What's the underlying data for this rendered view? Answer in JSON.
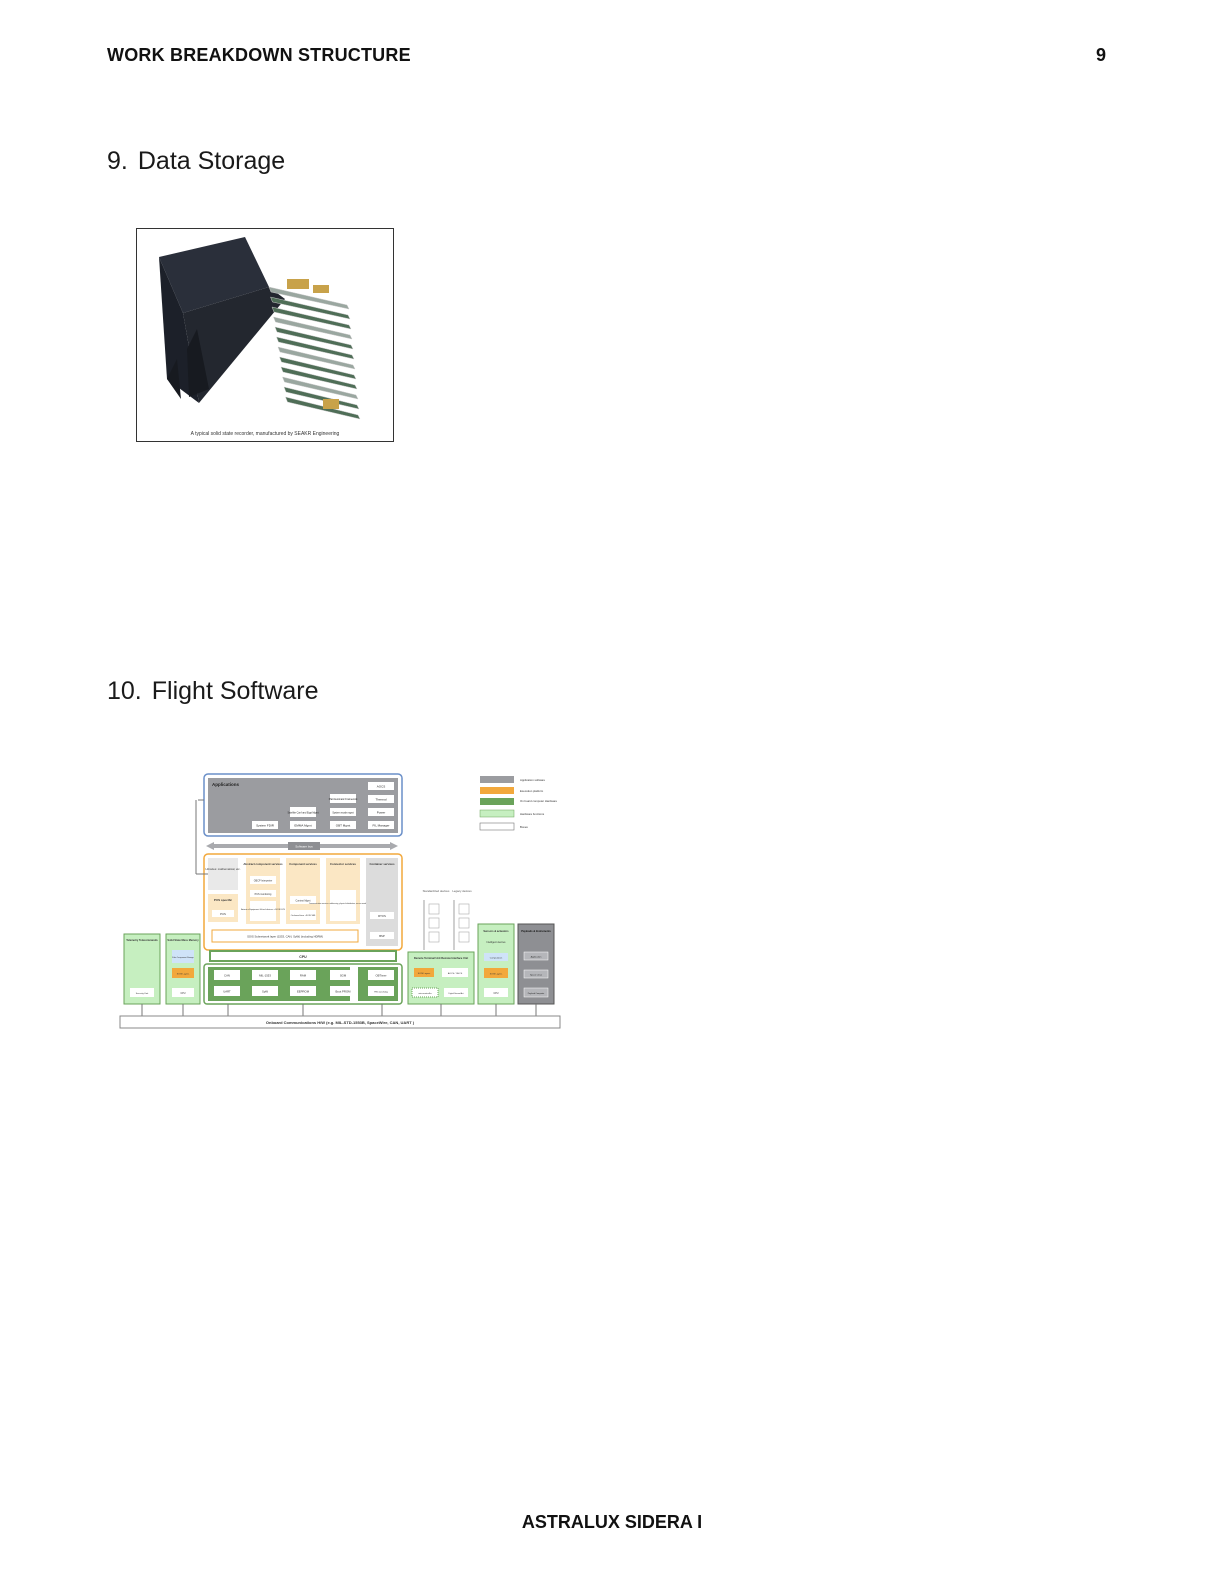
{
  "header": {
    "title": "WORK BREAKDOWN STRUCTURE",
    "page_number": "9"
  },
  "sections": [
    {
      "number": "9.",
      "title": "Data Storage"
    },
    {
      "number": "10.",
      "title": "Flight Software"
    }
  ],
  "figure_photo": {
    "caption": "A typical solid state recorder, manufactured by SEAKR Engineering"
  },
  "diagram": {
    "applications": {
      "title": "Applications",
      "items": [
        "AOCS",
        "Thermal",
        "Power",
        "FIL Manager",
        "Platt Automatic Framework",
        "System mode mgmt",
        "OBT Mgmt",
        "Satellite Conf and Eqpt Mgmt",
        "EMMA Mgmt",
        "System FDIR"
      ]
    },
    "software_bus": "Software bus",
    "columns": {
      "libraries": "Libraries: mathematical, etc.",
      "pus_specific": "PUS specific",
      "pus": "PUS",
      "abstract": "Abstract component services",
      "obcp": "OBCP Interpreter",
      "pus_monitoring": "PUS monitoring",
      "avionics": "Avionics Equipment Virtual devices +SOIS DVS",
      "component": "Component services",
      "context": "Context Mgmt",
      "onboard_time": "On-board time +SOIS TAS",
      "connector": "Connector services",
      "communication": "Communication services: addressing, physical distribution, access mode + SOIS MTS",
      "container": "Container services",
      "rtos": "RTOS",
      "bsp": "BSP",
      "sois_subnetwork": "SOIS Subnetwork layer (1553, CAN, SpW) (including HDRM)"
    },
    "hardware": {
      "cpu": "CPU",
      "row1": [
        "CAN",
        "MIL-1553",
        "RAM",
        "SGM",
        "OBTimer"
      ],
      "row2": [
        "UART",
        "SpW",
        "EEPROM",
        "Boot PROM",
        "HW watchdog"
      ]
    },
    "tmtc": {
      "title": "Telemetry Telecommands",
      "unit": "Security Unit"
    },
    "ssmm": {
      "title": "Solid State Mass Memory",
      "files": "Files Component Storage",
      "sois": "SOIS Layers",
      "cpu": "CPU"
    },
    "devices": {
      "standardized": "Standardized devices",
      "legacy": "Legacy devices"
    },
    "rtu": {
      "title": "Remote Terminal Unit Remote Interface Unit",
      "sois": "SOIS Layers",
      "aocs": "AOCS / OHCS",
      "micro": "microcontroller",
      "digital": "Digital Sensor/Act"
    },
    "sensors": {
      "title": "Sensors & actuators",
      "intelligent": "Intelligent devices",
      "computation": "Computation",
      "sois": "SOIS Layers",
      "cpu": "CPU"
    },
    "payloads": {
      "title": "Payloads & Instruments",
      "application": "Application",
      "space_linux": "Space Linux",
      "payload_computer": "Payload Computer"
    },
    "bus": "Onboard Communications H/W (e.g. MIL-STD-1553B, SpaceWire, CAN, UART )",
    "legend": [
      "Application software",
      "Execution platform",
      "On board computer Hardware",
      "Hardware functions",
      "Boxes"
    ],
    "colors": {
      "app": "#9b9ca0",
      "exec": "#f2a83c",
      "hw": "#6aa35a",
      "hwfunc": "#c6efc0",
      "box_border": "#6a8fc8",
      "exec_fill": "#fbe7c4"
    }
  },
  "footer": {
    "text": "ASTRALUX SIDERA I"
  }
}
